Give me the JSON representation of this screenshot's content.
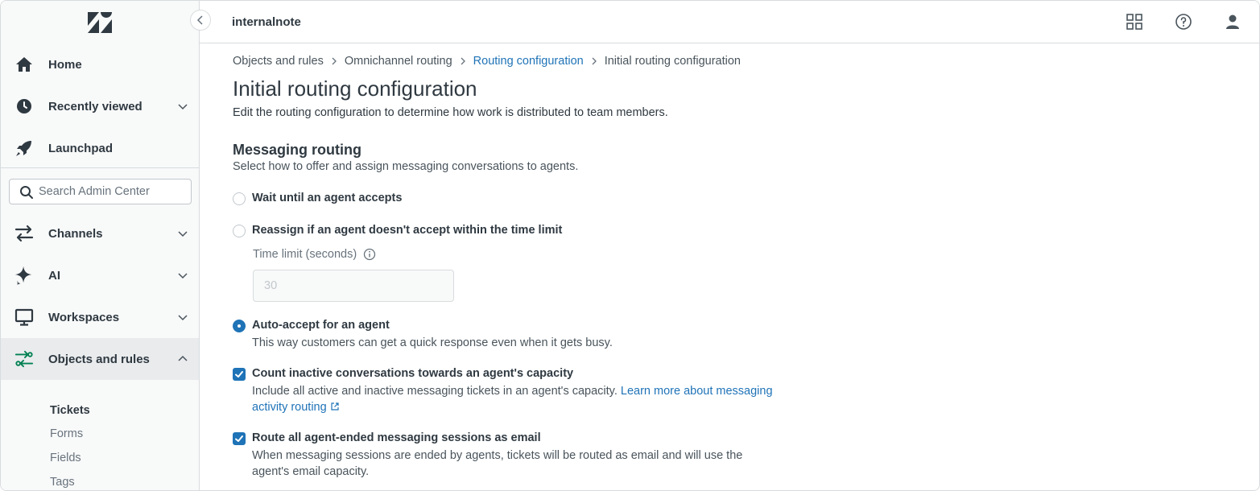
{
  "header": {
    "workspace": "internalnote",
    "icons": [
      "products-grid-icon",
      "help-icon",
      "user-profile-icon"
    ]
  },
  "sidebar": {
    "logo": "zendesk-logo",
    "top_items": [
      {
        "label": "Home",
        "icon": "home-icon"
      },
      {
        "label": "Recently viewed",
        "icon": "clock-icon"
      },
      {
        "label": "Launchpad",
        "icon": "rocket-icon"
      }
    ],
    "search": {
      "placeholder": "Search Admin Center",
      "value": ""
    },
    "items": [
      {
        "label": "Channels",
        "icon": "channels-icon"
      },
      {
        "label": "AI",
        "icon": "ai-sparkle-icon"
      },
      {
        "label": "Workspaces",
        "icon": "monitor-icon"
      },
      {
        "label": "Objects and rules",
        "icon": "objects-rules-icon"
      }
    ],
    "subitems": [
      "Tickets",
      "Forms",
      "Fields",
      "Tags"
    ]
  },
  "breadcrumb": [
    "Objects and rules",
    "Omnichannel routing",
    "Routing configuration",
    "Initial routing configuration"
  ],
  "page": {
    "title": "Initial routing configuration",
    "description": "Edit the routing configuration to determine how work is distributed to team members."
  },
  "messaging": {
    "title": "Messaging routing",
    "description": "Select how to offer and assign messaging conversations to agents.",
    "option_wait": "Wait until an agent accepts",
    "option_reassign": "Reassign if an agent doesn't accept within the time limit",
    "time_limit_label": "Time limit (seconds)",
    "time_limit_placeholder": "30",
    "option_auto": "Auto-accept for an agent",
    "option_auto_desc": "This way customers can get a quick response even when it gets busy.",
    "count_inactive_label": "Count inactive conversations towards an agent's capacity",
    "count_inactive_desc": "Include all active and inactive messaging tickets in an agent's capacity.",
    "count_inactive_link": "Learn more about messaging activity routing",
    "route_email_label": "Route all agent-ended messaging sessions as email",
    "route_email_desc": "When messaging sessions are ended by agents, tickets will be routed as email and will use the agent's email capacity."
  },
  "colors": {
    "accent": "#1f73b7",
    "active_nav_bg": "#e9ebed"
  }
}
